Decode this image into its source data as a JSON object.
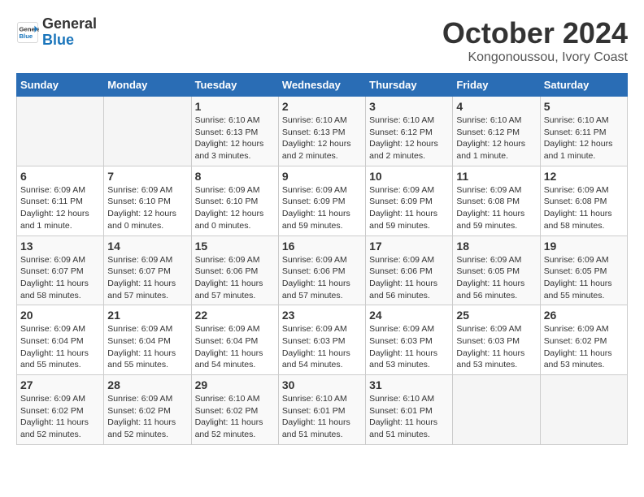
{
  "header": {
    "logo_line1": "General",
    "logo_line2": "Blue",
    "month": "October 2024",
    "location": "Kongonoussou, Ivory Coast"
  },
  "weekdays": [
    "Sunday",
    "Monday",
    "Tuesday",
    "Wednesday",
    "Thursday",
    "Friday",
    "Saturday"
  ],
  "weeks": [
    [
      {
        "day": "",
        "info": ""
      },
      {
        "day": "",
        "info": ""
      },
      {
        "day": "1",
        "info": "Sunrise: 6:10 AM\nSunset: 6:13 PM\nDaylight: 12 hours\nand 3 minutes."
      },
      {
        "day": "2",
        "info": "Sunrise: 6:10 AM\nSunset: 6:13 PM\nDaylight: 12 hours\nand 2 minutes."
      },
      {
        "day": "3",
        "info": "Sunrise: 6:10 AM\nSunset: 6:12 PM\nDaylight: 12 hours\nand 2 minutes."
      },
      {
        "day": "4",
        "info": "Sunrise: 6:10 AM\nSunset: 6:12 PM\nDaylight: 12 hours\nand 1 minute."
      },
      {
        "day": "5",
        "info": "Sunrise: 6:10 AM\nSunset: 6:11 PM\nDaylight: 12 hours\nand 1 minute."
      }
    ],
    [
      {
        "day": "6",
        "info": "Sunrise: 6:09 AM\nSunset: 6:11 PM\nDaylight: 12 hours\nand 1 minute."
      },
      {
        "day": "7",
        "info": "Sunrise: 6:09 AM\nSunset: 6:10 PM\nDaylight: 12 hours\nand 0 minutes."
      },
      {
        "day": "8",
        "info": "Sunrise: 6:09 AM\nSunset: 6:10 PM\nDaylight: 12 hours\nand 0 minutes."
      },
      {
        "day": "9",
        "info": "Sunrise: 6:09 AM\nSunset: 6:09 PM\nDaylight: 11 hours\nand 59 minutes."
      },
      {
        "day": "10",
        "info": "Sunrise: 6:09 AM\nSunset: 6:09 PM\nDaylight: 11 hours\nand 59 minutes."
      },
      {
        "day": "11",
        "info": "Sunrise: 6:09 AM\nSunset: 6:08 PM\nDaylight: 11 hours\nand 59 minutes."
      },
      {
        "day": "12",
        "info": "Sunrise: 6:09 AM\nSunset: 6:08 PM\nDaylight: 11 hours\nand 58 minutes."
      }
    ],
    [
      {
        "day": "13",
        "info": "Sunrise: 6:09 AM\nSunset: 6:07 PM\nDaylight: 11 hours\nand 58 minutes."
      },
      {
        "day": "14",
        "info": "Sunrise: 6:09 AM\nSunset: 6:07 PM\nDaylight: 11 hours\nand 57 minutes."
      },
      {
        "day": "15",
        "info": "Sunrise: 6:09 AM\nSunset: 6:06 PM\nDaylight: 11 hours\nand 57 minutes."
      },
      {
        "day": "16",
        "info": "Sunrise: 6:09 AM\nSunset: 6:06 PM\nDaylight: 11 hours\nand 57 minutes."
      },
      {
        "day": "17",
        "info": "Sunrise: 6:09 AM\nSunset: 6:06 PM\nDaylight: 11 hours\nand 56 minutes."
      },
      {
        "day": "18",
        "info": "Sunrise: 6:09 AM\nSunset: 6:05 PM\nDaylight: 11 hours\nand 56 minutes."
      },
      {
        "day": "19",
        "info": "Sunrise: 6:09 AM\nSunset: 6:05 PM\nDaylight: 11 hours\nand 55 minutes."
      }
    ],
    [
      {
        "day": "20",
        "info": "Sunrise: 6:09 AM\nSunset: 6:04 PM\nDaylight: 11 hours\nand 55 minutes."
      },
      {
        "day": "21",
        "info": "Sunrise: 6:09 AM\nSunset: 6:04 PM\nDaylight: 11 hours\nand 55 minutes."
      },
      {
        "day": "22",
        "info": "Sunrise: 6:09 AM\nSunset: 6:04 PM\nDaylight: 11 hours\nand 54 minutes."
      },
      {
        "day": "23",
        "info": "Sunrise: 6:09 AM\nSunset: 6:03 PM\nDaylight: 11 hours\nand 54 minutes."
      },
      {
        "day": "24",
        "info": "Sunrise: 6:09 AM\nSunset: 6:03 PM\nDaylight: 11 hours\nand 53 minutes."
      },
      {
        "day": "25",
        "info": "Sunrise: 6:09 AM\nSunset: 6:03 PM\nDaylight: 11 hours\nand 53 minutes."
      },
      {
        "day": "26",
        "info": "Sunrise: 6:09 AM\nSunset: 6:02 PM\nDaylight: 11 hours\nand 53 minutes."
      }
    ],
    [
      {
        "day": "27",
        "info": "Sunrise: 6:09 AM\nSunset: 6:02 PM\nDaylight: 11 hours\nand 52 minutes."
      },
      {
        "day": "28",
        "info": "Sunrise: 6:09 AM\nSunset: 6:02 PM\nDaylight: 11 hours\nand 52 minutes."
      },
      {
        "day": "29",
        "info": "Sunrise: 6:10 AM\nSunset: 6:02 PM\nDaylight: 11 hours\nand 52 minutes."
      },
      {
        "day": "30",
        "info": "Sunrise: 6:10 AM\nSunset: 6:01 PM\nDaylight: 11 hours\nand 51 minutes."
      },
      {
        "day": "31",
        "info": "Sunrise: 6:10 AM\nSunset: 6:01 PM\nDaylight: 11 hours\nand 51 minutes."
      },
      {
        "day": "",
        "info": ""
      },
      {
        "day": "",
        "info": ""
      }
    ]
  ]
}
